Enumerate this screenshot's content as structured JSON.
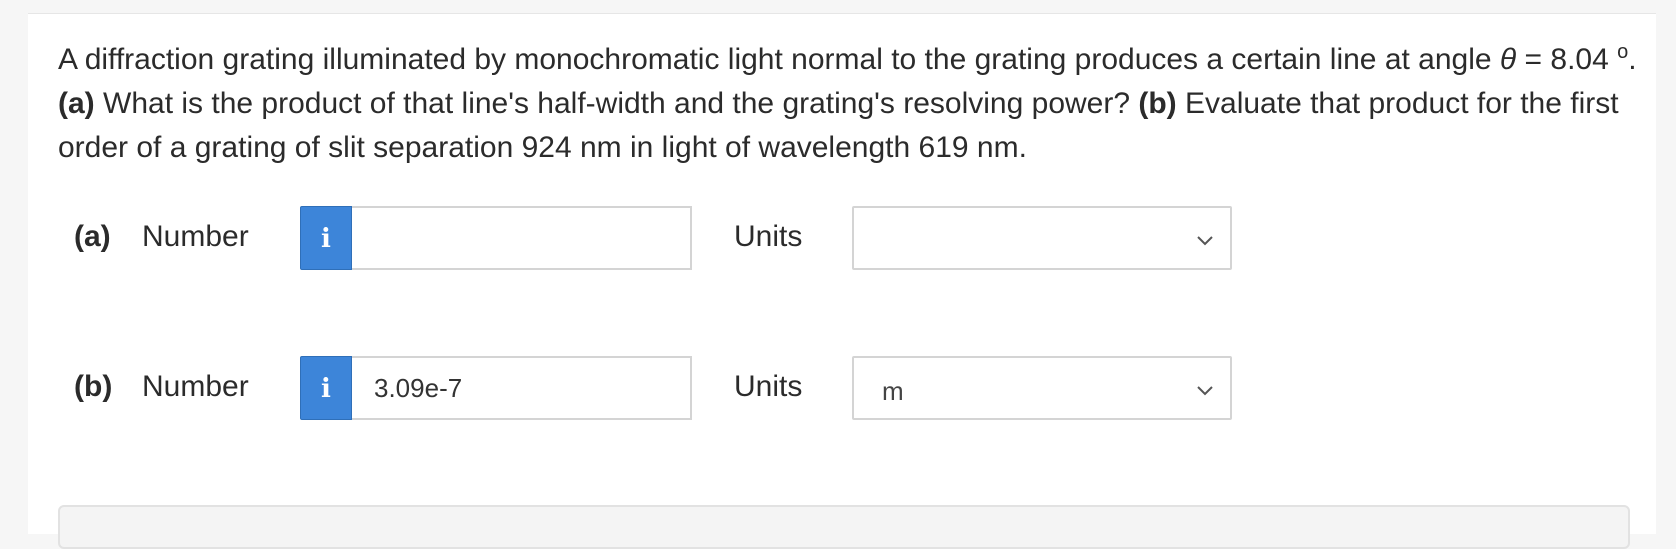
{
  "question": {
    "text1": "A diffraction grating illuminated by monochromatic light normal to the grating produces a certain line at angle ",
    "theta": "θ",
    "text2": " = 8.04 ",
    "degree": "o",
    "text3": ". ",
    "part_a_tag": "(a)",
    "text4": " What is the product of that line's half-width and the grating's resolving power? ",
    "part_b_tag": "(b)",
    "text5": " Evaluate that product for the first order of a grating of slit separation 924 nm in light of wavelength 619 nm."
  },
  "rows": [
    {
      "part": "(a)",
      "number_label": "Number",
      "info": "i",
      "value": "",
      "units_label": "Units",
      "units_value": ""
    },
    {
      "part": "(b)",
      "number_label": "Number",
      "info": "i",
      "value": "3.09e-7",
      "units_label": "Units",
      "units_value": "m"
    }
  ],
  "colors": {
    "info_button": "#3d85d9",
    "background": "#f6f6f6"
  },
  "icons": {
    "info": "info-icon",
    "dropdown": "chevron-down-icon"
  }
}
